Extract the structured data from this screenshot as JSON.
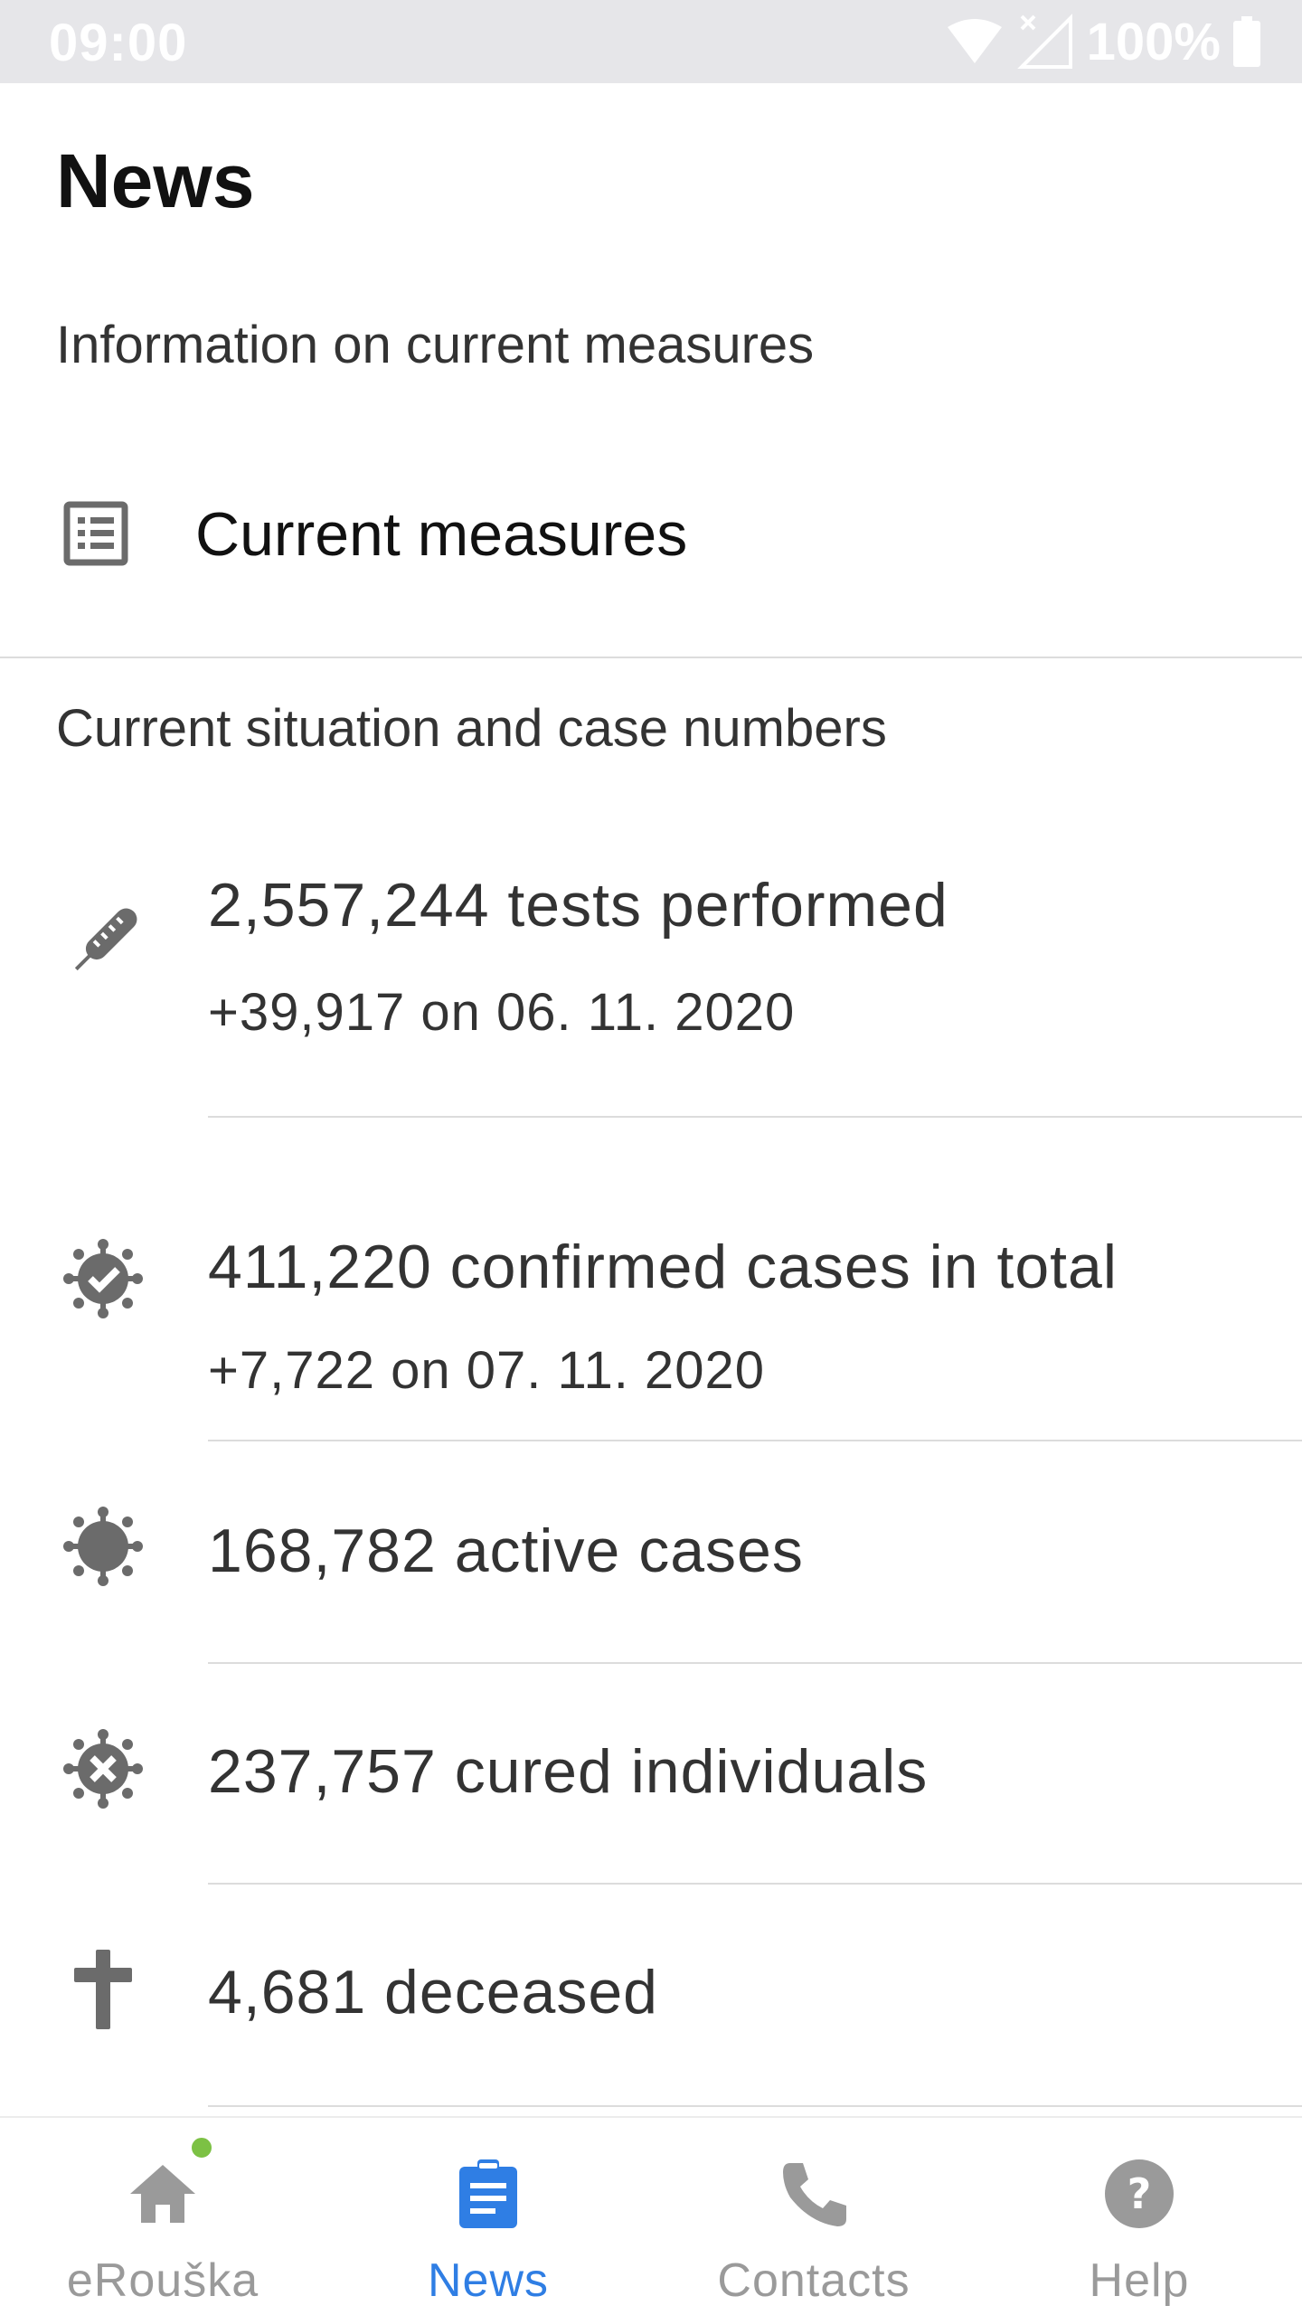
{
  "status_bar": {
    "time": "09:00",
    "battery": "100%",
    "icons": [
      "wifi-icon",
      "cell-signal-icon",
      "battery-icon"
    ]
  },
  "header": {
    "title": "News"
  },
  "info_section": {
    "label": "Information on current measures",
    "measures_link": {
      "label": "Current measures",
      "icon": "list-document-icon"
    }
  },
  "stats_section": {
    "label": "Current situation and case numbers",
    "items": [
      {
        "main": "2,557,244 tests performed",
        "sub": "+39,917 on 06. 11. 2020",
        "icon": "thermometer-icon"
      },
      {
        "main": "411,220 confirmed cases in total",
        "sub": "+7,722 on 07. 11. 2020",
        "icon": "virus-check-icon"
      },
      {
        "main": "168,782 active cases",
        "icon": "virus-icon"
      },
      {
        "main": "237,757 cured individuals",
        "icon": "virus-cross-icon"
      },
      {
        "main": "4,681 deceased",
        "icon": "cross-icon"
      }
    ]
  },
  "bottom_nav": {
    "items": [
      {
        "label": "eRouška",
        "icon": "home-icon",
        "active": false,
        "badge": true
      },
      {
        "label": "News",
        "icon": "clipboard-icon",
        "active": true
      },
      {
        "label": "Contacts",
        "icon": "phone-icon",
        "active": false
      },
      {
        "label": "Help",
        "icon": "help-icon",
        "active": false
      }
    ]
  },
  "colors": {
    "accent": "#2f7ee4",
    "icon_gray": "#6b6b6b",
    "inactive_gray": "#9a9a9a",
    "badge_green": "#7cc144",
    "status_bar_bg": "#e6e6e9"
  }
}
